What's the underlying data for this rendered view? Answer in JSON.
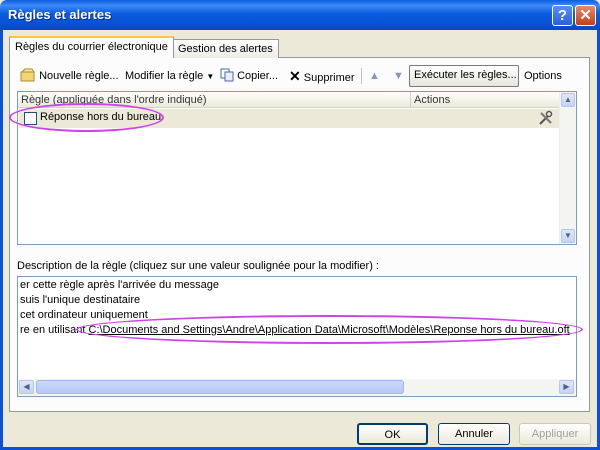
{
  "window": {
    "title": "Règles et alertes",
    "help_label": "?",
    "close_label": "✕"
  },
  "tabs": [
    {
      "label": "Règles du courrier électronique"
    },
    {
      "label": "Gestion des alertes"
    }
  ],
  "toolbar": {
    "new_rule": "Nouvelle règle...",
    "modify_rule": "Modifier la règle",
    "copy": "Copier...",
    "delete": "Supprimer",
    "run_rules": "Exécuter les règles...",
    "options": "Options"
  },
  "rules_table": {
    "columns": [
      "Règle (appliquée dans l'ordre indiqué)",
      "Actions"
    ],
    "rows": [
      {
        "name": "Réponse hors du bureau",
        "checked": false
      }
    ]
  },
  "description": {
    "label": "Description de la règle (cliquez sur une valeur soulignée pour la modifier) :",
    "lines": [
      "er cette règle après l'arrivée du message",
      "suis l'unique destinataire",
      "cet ordinateur uniquement",
      "re en utilisant"
    ],
    "template_path": "C:\\Documents and Settings\\Andre\\Application Data\\Microsoft\\Modèles\\Reponse hors du bureau.oft"
  },
  "buttons": {
    "ok": "OK",
    "cancel": "Annuler",
    "apply": "Appliquer"
  },
  "colors": {
    "title_bar": "#0a5ee0",
    "annotation": "#cc44e8",
    "selected_row": "#ece9d8"
  }
}
